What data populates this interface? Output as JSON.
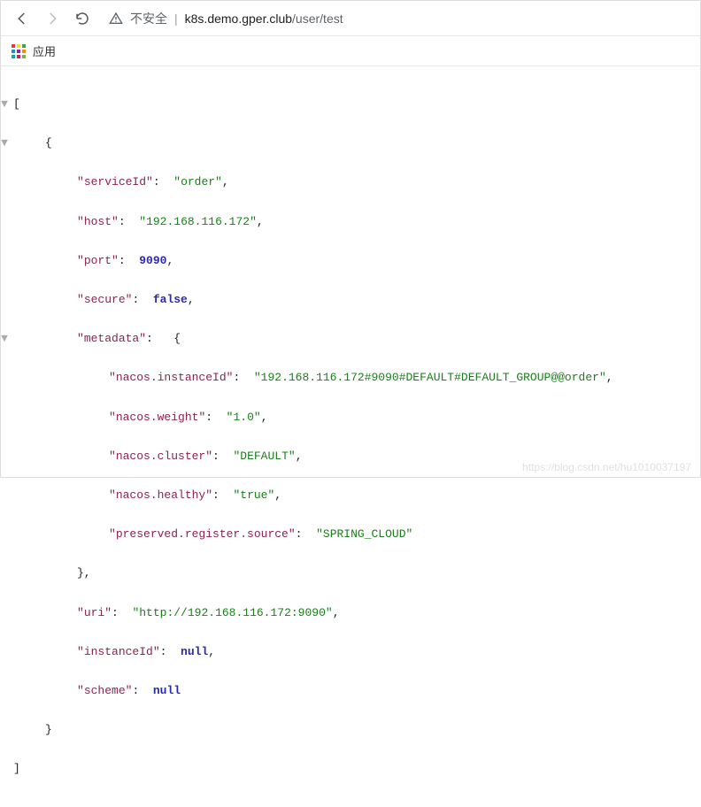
{
  "browser": {
    "insecure_label": "不安全",
    "url_host": "k8s.demo.gper.club",
    "url_path": "/user/test",
    "apps_label": "应用"
  },
  "json": {
    "serviceId_key": "serviceId",
    "serviceId_val": "order",
    "host_key": "host",
    "host_val": "192.168.116.172",
    "port_key": "port",
    "port_val": "9090",
    "secure_key": "secure",
    "secure_val": "false",
    "metadata_key": "metadata",
    "meta_instanceId_key": "nacos.instanceId",
    "meta_instanceId_val": "192.168.116.172#9090#DEFAULT#DEFAULT_GROUP@@order",
    "meta_weight_key": "nacos.weight",
    "meta_weight_val": "1.0",
    "meta_cluster_key": "nacos.cluster",
    "meta_cluster_val": "DEFAULT",
    "meta_healthy_key": "nacos.healthy",
    "meta_healthy_val": "true",
    "meta_source_key": "preserved.register.source",
    "meta_source_val": "SPRING_CLOUD",
    "uri_key": "uri",
    "uri_val": "http://192.168.116.172:9090",
    "instanceId_key": "instanceId",
    "instanceId_val": "null",
    "scheme_key": "scheme",
    "scheme_val": "null"
  },
  "watermark": "https://blog.csdn.net/hu1010037197"
}
